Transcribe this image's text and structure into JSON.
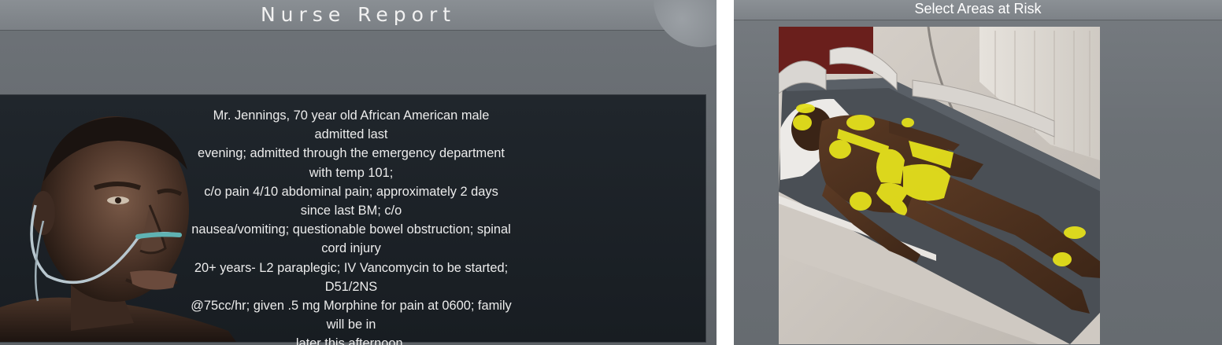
{
  "nurse_report": {
    "title": "Nurse Report",
    "lines": [
      "Mr. Jennings, 70 year old African American male admitted last",
      "evening; admitted through the emergency department with temp 101;",
      "c/o pain 4/10 abdominal pain; approximately 2 days since last BM; c/o",
      "nausea/vomiting; questionable bowel obstruction; spinal cord injury",
      "20+ years- L2 paraplegic; IV Vancomycin to be started; D51/2NS",
      "@75cc/hr; given .5 mg Morphine for pain at 0600; family will be in",
      "later this afternoon."
    ]
  },
  "risk_selection": {
    "title": "Select Areas at Risk",
    "highlight_color": "#e4e01c",
    "areas": [
      "ear",
      "cheek",
      "shoulder-blade-left",
      "shoulder-blade-right",
      "spine-upper",
      "spine-mid",
      "elbow",
      "sacrum",
      "coccyx",
      "buttock-left",
      "buttock-right",
      "hip",
      "heel-left",
      "heel-right"
    ]
  }
}
